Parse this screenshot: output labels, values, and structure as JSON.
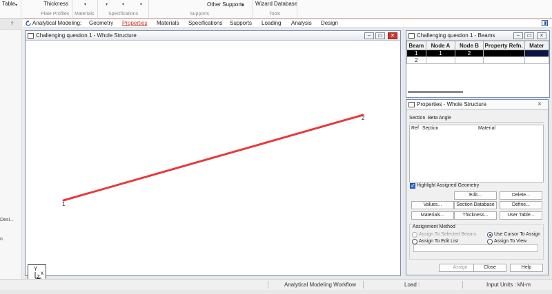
{
  "ribbon": {
    "table_label": "Table",
    "thickness_label": "Thickness",
    "group_plate_profiles": "Plate Profiles",
    "group_materials": "Materials",
    "group_specifications": "Specifications",
    "other_supports": "Other Supports",
    "group_supports": "Supports",
    "wizard": "Wizard",
    "database": "Database",
    "group_tools": "Tools"
  },
  "left_panel": {
    "item1": "Desi...",
    "item2": "n"
  },
  "modeling_bar": {
    "label": "Analytical Modeling:",
    "tabs": [
      "Geometry",
      "Properties",
      "Materials",
      "Specifications",
      "Supports",
      "Loading",
      "Analysis",
      "Design"
    ],
    "active_tab": "Properties"
  },
  "structure_window": {
    "title": "Challenging question 1 - Whole Structure",
    "node1_label": "1",
    "node2_label": "2",
    "axis_y": "Y",
    "axis_x": "x",
    "axis_z": "Z",
    "beam_color": "#e83a3a"
  },
  "beams_window": {
    "title": "Challenging question 1 - Beams",
    "columns": [
      "Beam",
      "Node A",
      "Node B",
      "Property Refn.",
      "Mater"
    ],
    "rows": [
      [
        "1",
        "1",
        "2",
        "",
        ""
      ],
      [
        "2",
        "",
        "",
        "",
        ""
      ]
    ]
  },
  "properties_window": {
    "title": "Properties - Whole Structure",
    "tab_section": "Section",
    "tab_beta": "Beta Angle",
    "col_ref": "Ref",
    "col_section": "Section",
    "col_material": "Material",
    "highlight_label": "Highlight Assigned Geometry",
    "btn_edit": "Edit...",
    "btn_delete": "Delete...",
    "btn_values": "Values...",
    "btn_section_db": "Section Database",
    "btn_define": "Define...",
    "btn_materials": "Materials...",
    "btn_thickness": "Thickness...",
    "btn_user_table": "User Table...",
    "assign_method": "Assignment Method",
    "opt_selected": "Assign To Selected Beams",
    "opt_cursor": "Use Cursor To Assign",
    "opt_edit_list": "Assign To Edit List",
    "opt_view": "Assign To View",
    "btn_assign": "Assign",
    "btn_close": "Close",
    "btn_help": "Help"
  },
  "status_bar": {
    "workflow": "Analytical Modeling Workflow",
    "load": "Load :",
    "units": "Input Units : kN-m"
  }
}
